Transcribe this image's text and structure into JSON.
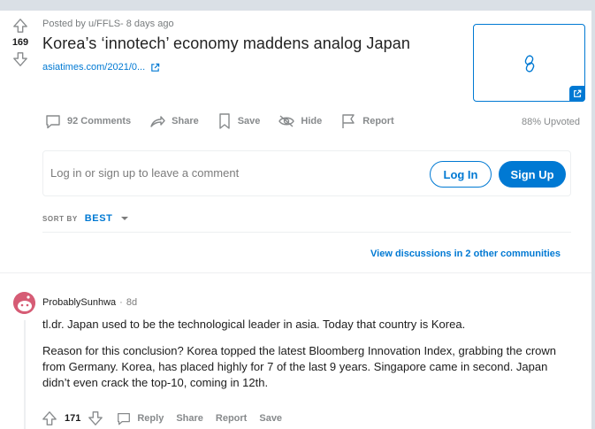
{
  "post": {
    "score": "169",
    "meta": "Posted by u/FFLS- 8 days ago",
    "title": "Korea’s ‘innotech’ economy maddens analog Japan",
    "link_text": "asiatimes.com/2021/0...",
    "actions": {
      "comments": "92 Comments",
      "share": "Share",
      "save": "Save",
      "hide": "Hide",
      "report": "Report"
    },
    "upvoted": "88% Upvoted"
  },
  "login_prompt": {
    "text": "Log in or sign up to leave a comment",
    "login_label": "Log In",
    "signup_label": "Sign Up"
  },
  "sort": {
    "label": "SORT BY",
    "value": "BEST"
  },
  "view_discussions": "View discussions in 2 other communities",
  "comment": {
    "author": "ProbablySunhwa",
    "separator": "·",
    "time": "8d",
    "paragraphs": [
      "tl.dr. Japan used to be the technological leader in asia. Today that country is Korea.",
      "Reason for this conclusion? Korea topped the latest Bloomberg Innovation Index, grabbing the crown from Germany. Korea, has placed highly for 7 of the last 9 years. Singapore came in second. Japan didn’t even crack the top-10, coming in 12th."
    ],
    "score": "171",
    "reply": "Reply",
    "share": "Share",
    "report": "Report",
    "save": "Save"
  },
  "colors": {
    "accent": "#0079d3",
    "background": "#dae0e6",
    "muted": "#878a8c"
  }
}
